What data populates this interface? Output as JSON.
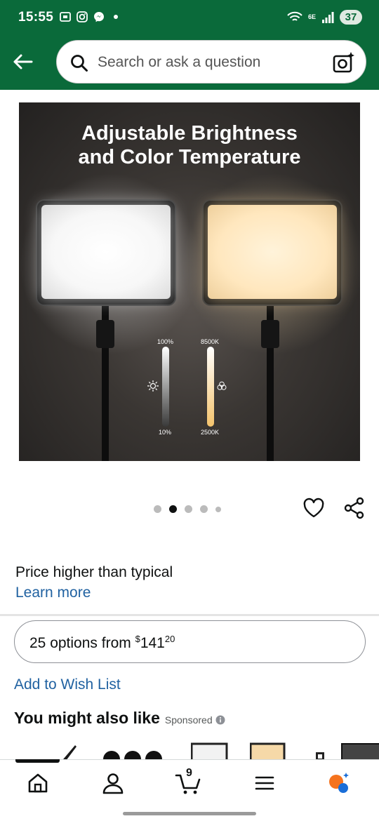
{
  "status_bar": {
    "time": "15:55",
    "network_label": "6E",
    "battery": "37",
    "left_icons": [
      "screenshot-icon",
      "instagram-icon",
      "messenger-icon",
      "dot-icon"
    ],
    "right_icons": [
      "wifi-icon",
      "signal-icon"
    ]
  },
  "header": {
    "search": {
      "placeholder": "Search or ask a question"
    },
    "icons": [
      "back-arrow-icon",
      "search-icon",
      "camera-icon"
    ]
  },
  "product_image": {
    "headline_line1": "Adjustable Brightness",
    "headline_line2": "and Color Temperature",
    "brightness_max": "100%",
    "brightness_min": "10%",
    "temp_max": "8500K",
    "temp_min": "2500K"
  },
  "carousel": {
    "dot_count": 5,
    "active_index": 1
  },
  "price_note": {
    "text": "Price higher than typical",
    "link": "Learn more"
  },
  "options": {
    "prefix": "25 options from ",
    "currency": "$",
    "whole": "141",
    "fraction": "20"
  },
  "wishlist": {
    "label": "Add to Wish List"
  },
  "also_like": {
    "title": "You might also like",
    "sponsored": "Sponsored"
  },
  "bottom_nav": {
    "cart_count": "9",
    "items": [
      "home-icon",
      "account-icon",
      "cart-icon",
      "menu-icon",
      "rufus-icon"
    ]
  },
  "colors": {
    "header_green": "#0a6a3a",
    "link_blue": "#2162a1",
    "text": "#0f1111"
  }
}
